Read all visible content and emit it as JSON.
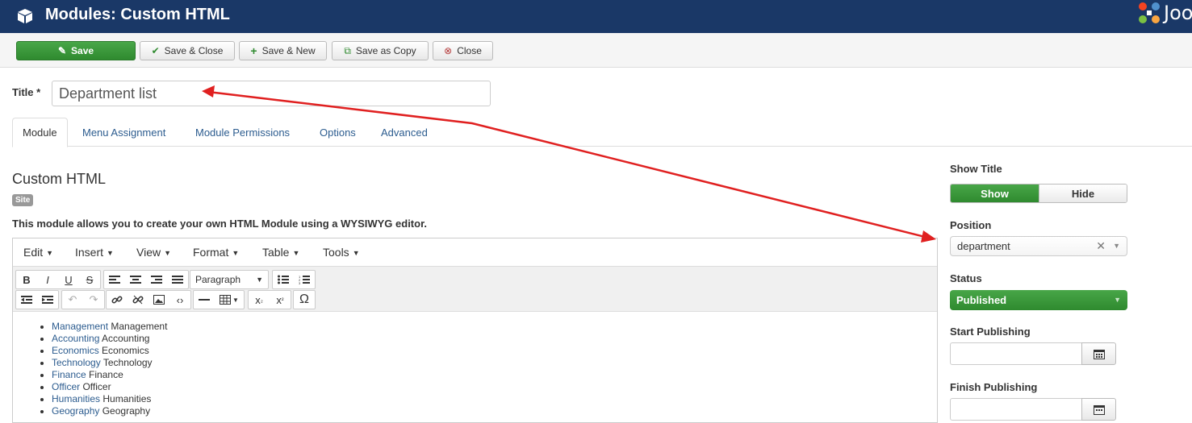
{
  "header": {
    "title": "Modules: Custom HTML",
    "logo_text": "Joomla!"
  },
  "toolbar": {
    "save": "Save",
    "save_close": "Save & Close",
    "save_new": "Save & New",
    "save_copy": "Save as Copy",
    "close": "Close"
  },
  "form": {
    "title_label": "Title *",
    "title_value": "Department list"
  },
  "tabs": [
    "Module",
    "Menu Assignment",
    "Module Permissions",
    "Options",
    "Advanced"
  ],
  "module": {
    "heading": "Custom HTML",
    "badge": "Site",
    "description": "This module allows you to create your own HTML Module using a WYSIWYG editor."
  },
  "editor": {
    "menus": [
      "Edit",
      "Insert",
      "View",
      "Format",
      "Table",
      "Tools"
    ],
    "format_select": "Paragraph",
    "list_items": [
      {
        "link": "Management",
        "text": "Management"
      },
      {
        "link": "Accounting",
        "text": "Accounting"
      },
      {
        "link": "Economics",
        "text": "Economics"
      },
      {
        "link": "Technology",
        "text": "Technology"
      },
      {
        "link": "Finance",
        "text": "Finance"
      },
      {
        "link": "Officer",
        "text": "Officer"
      },
      {
        "link": "Humanities",
        "text": "Humanities"
      },
      {
        "link": "Geography",
        "text": "Geography"
      }
    ]
  },
  "sidebar": {
    "show_title_label": "Show Title",
    "show_label": "Show",
    "hide_label": "Hide",
    "position_label": "Position",
    "position_value": "department",
    "status_label": "Status",
    "status_value": "Published",
    "start_label": "Start Publishing",
    "finish_label": "Finish Publishing"
  },
  "colors": {
    "header_bg": "#1a3867",
    "accent_green": "#2f8a2f",
    "annotation_arrow": "#e02020"
  }
}
